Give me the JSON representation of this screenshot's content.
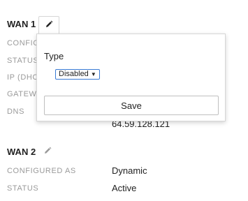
{
  "wan1": {
    "title": "WAN 1",
    "labels": {
      "configured": "CONFIG",
      "status": "STATUS",
      "ip": "IP (DHC",
      "gateway": "GATEW",
      "dns": "DNS"
    },
    "dns_value": "64.59.128.121"
  },
  "popover": {
    "type_label": "Type",
    "select_value": "Disabled",
    "save_label": "Save"
  },
  "wan2": {
    "title": "WAN 2",
    "configured_label": "CONFIGURED AS",
    "configured_value": "Dynamic",
    "status_label": "STATUS",
    "status_value": "Active"
  },
  "icons": {
    "edit": "pencil-icon",
    "dropdown": "triangle-down-icon"
  },
  "colors": {
    "label_gray": "#9a9a9a",
    "select_border": "#3a7bd5"
  }
}
